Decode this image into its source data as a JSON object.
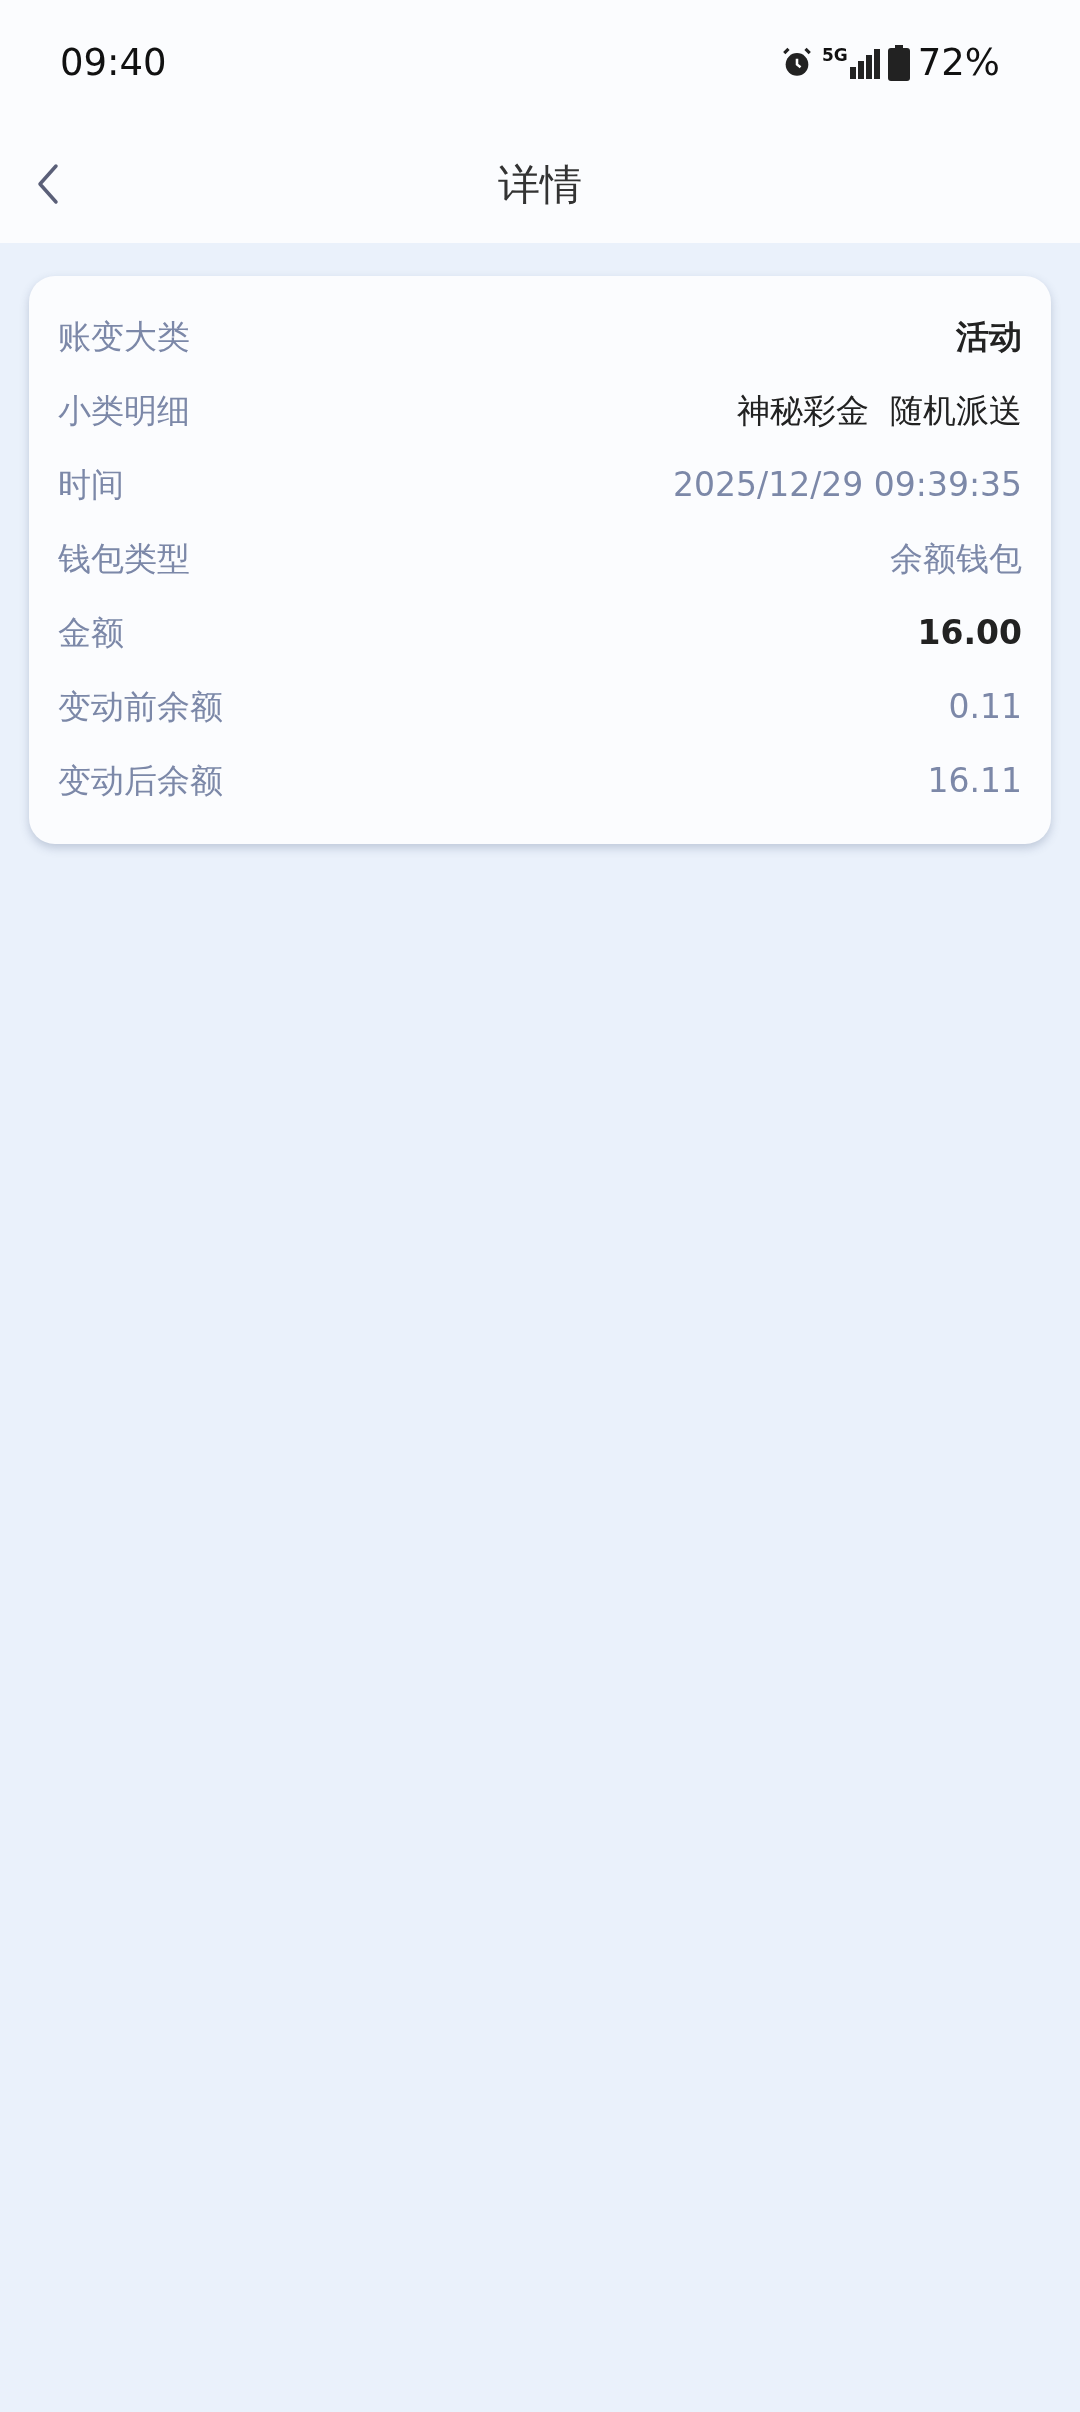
{
  "status_bar": {
    "time": "09:40",
    "network": "5G",
    "battery": "72%"
  },
  "header": {
    "title": "详情"
  },
  "details": [
    {
      "label": "账变大类",
      "value": "活动",
      "kind": "category"
    },
    {
      "label": "小类明细",
      "value": "神秘彩金  随机派送",
      "kind": "detail"
    },
    {
      "label": "时间",
      "value": "2025/12/29 09:39:35",
      "kind": "info"
    },
    {
      "label": "钱包类型",
      "value": "余额钱包",
      "kind": "info"
    },
    {
      "label": "金额",
      "value": "16.00",
      "kind": "amount"
    },
    {
      "label": "变动前余额",
      "value": "0.11",
      "kind": "info"
    },
    {
      "label": "变动后余额",
      "value": "16.11",
      "kind": "info"
    }
  ]
}
